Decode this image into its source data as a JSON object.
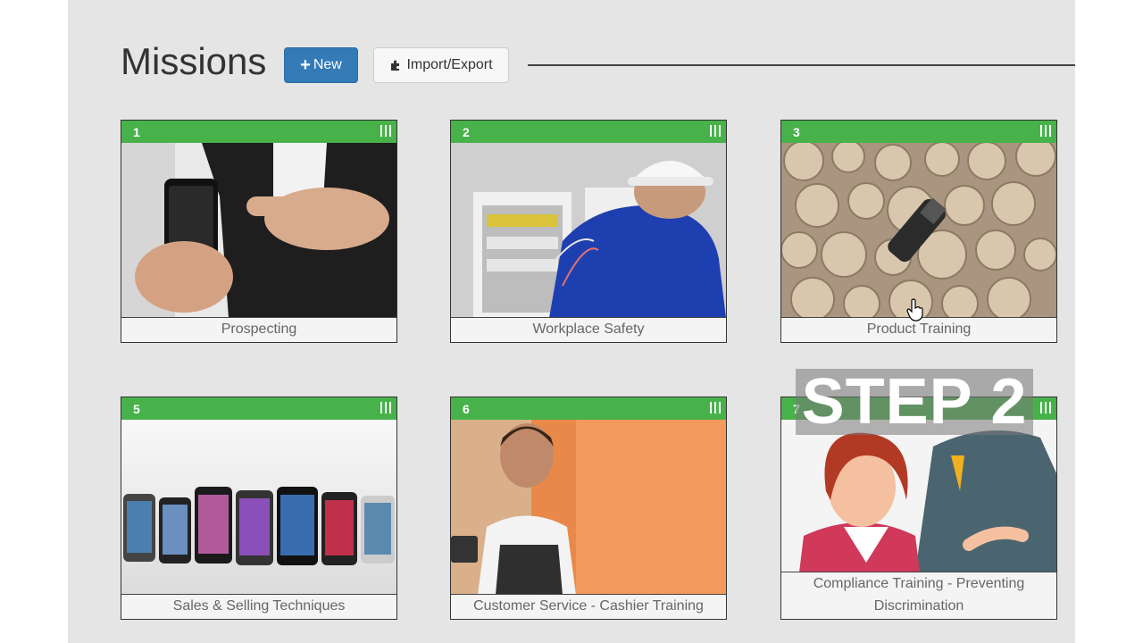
{
  "page": {
    "title": "Missions",
    "new_button": {
      "plus": "+",
      "label": "New"
    },
    "import_button": {
      "label": "Import/Export",
      "icon": "puzzle-piece-icon"
    }
  },
  "colors": {
    "card_bar": "#47b24a",
    "primary_button": "#337ab7",
    "panel": "#e5e5e5"
  },
  "missions": [
    {
      "number": "1",
      "title": "Prospecting"
    },
    {
      "number": "2",
      "title": "Workplace Safety"
    },
    {
      "number": "3",
      "title": "Product Training"
    },
    {
      "number": "5",
      "title": "Sales & Selling Techniques"
    },
    {
      "number": "6",
      "title": "Customer Service - Cashier Training"
    },
    {
      "number": "7",
      "title": "Compliance Training - Preventing Discrimination"
    }
  ],
  "overlay": {
    "text": "STEP 2"
  }
}
